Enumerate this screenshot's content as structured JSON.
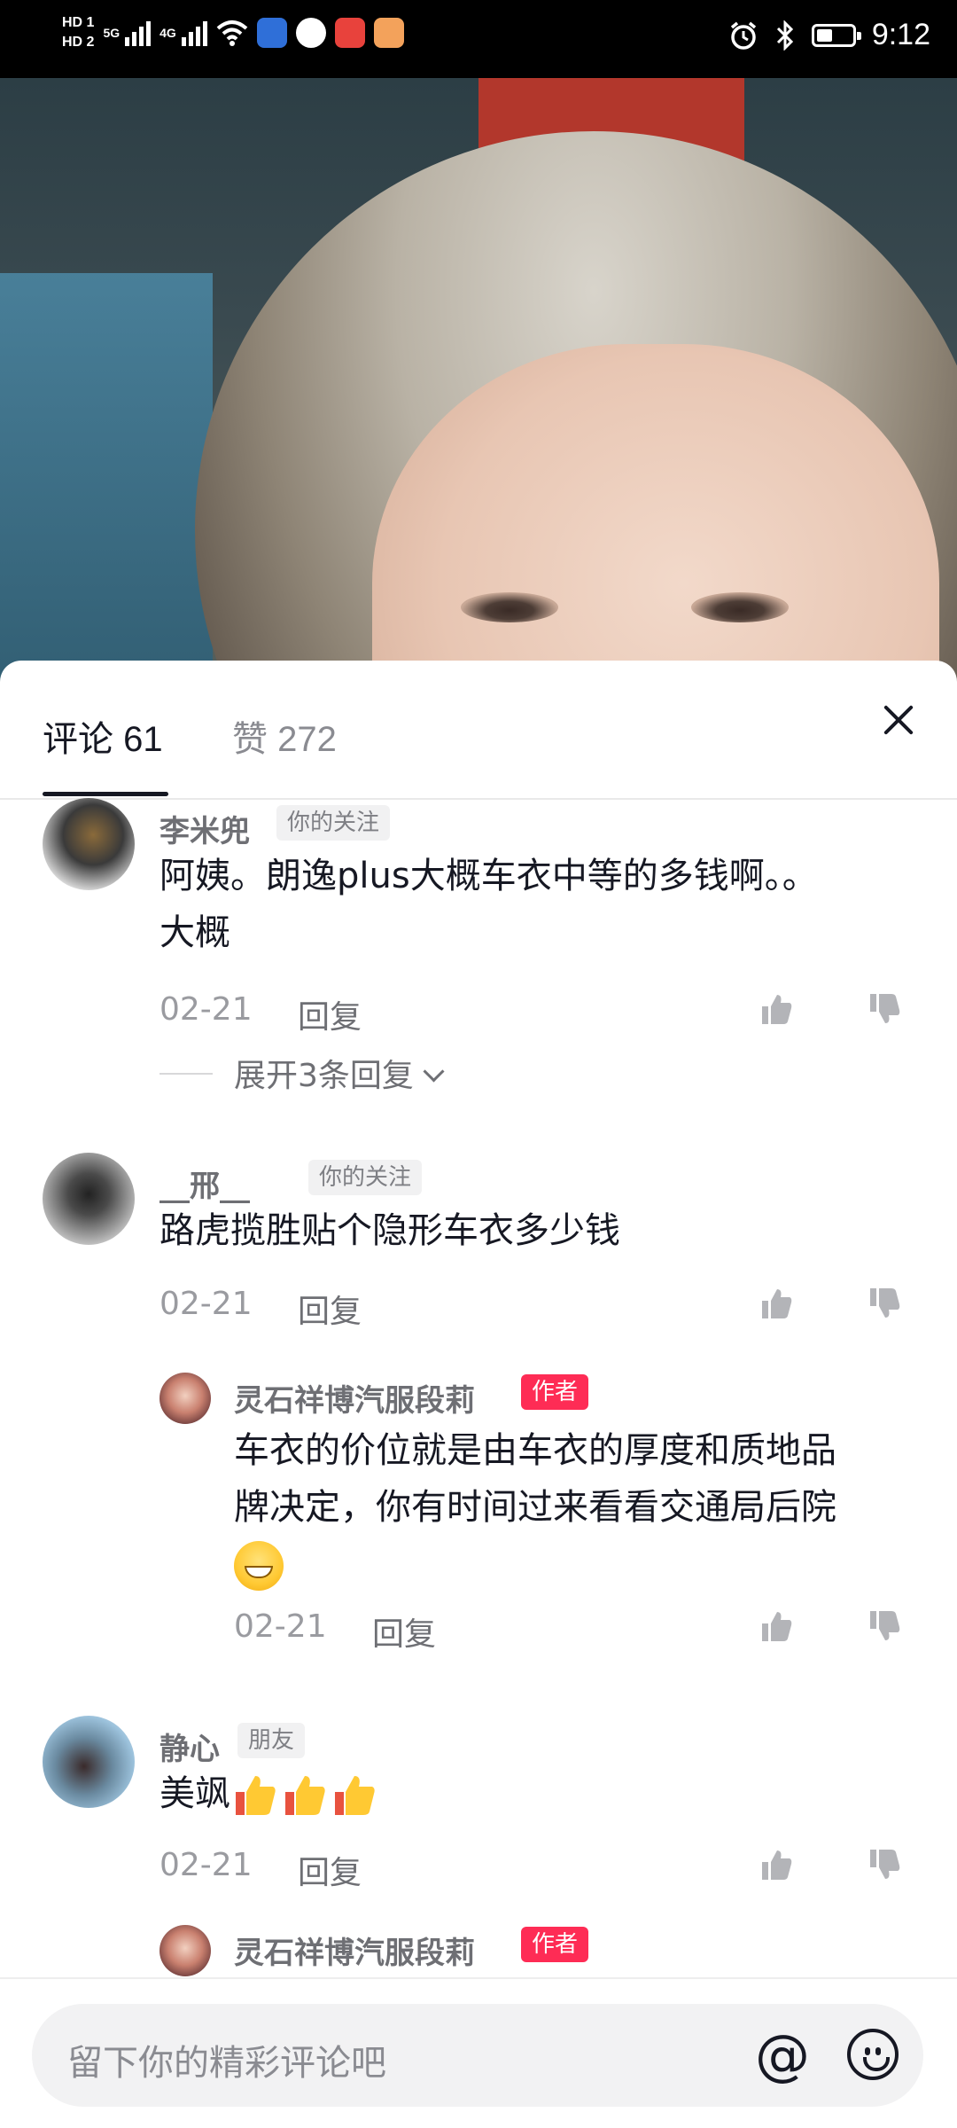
{
  "status_bar": {
    "hd1": "HD 1",
    "hd2": "HD 2",
    "net1": "5G",
    "net2": "4G",
    "time": "9:12",
    "battery_level": 0.45
  },
  "sheet": {
    "tabs": [
      {
        "label": "评论 61"
      },
      {
        "label": "赞 272"
      }
    ]
  },
  "comments": [
    {
      "username": "李米兜",
      "tag": "你的关注",
      "text_line1": "阿姨。朗逸plus大概车衣中等的多钱啊。。",
      "text_line2": "大概",
      "date": "02-21",
      "reply_label": "回复",
      "expand_label": "展开3条回复"
    },
    {
      "username": "__邢__",
      "tag": "你的关注",
      "text": "路虎揽胜贴个隐形车衣多少钱",
      "date": "02-21",
      "reply_label": "回复",
      "reply": {
        "username": "灵石祥博汽服段莉",
        "tag": "作者",
        "text_line1": "车衣的价位就是由车衣的厚度和质地品",
        "text_line2": "牌决定，你有时间过来看看交通局后院",
        "date": "02-21",
        "reply_label": "回复"
      }
    },
    {
      "username": "静心",
      "tag": "朋友",
      "text": "美飒",
      "date": "02-21",
      "reply_label": "回复",
      "reply": {
        "username": "灵石祥博汽服段莉",
        "tag": "作者"
      }
    }
  ],
  "input": {
    "placeholder": "留下你的精彩评论吧",
    "at_symbol": "@"
  },
  "colors": {
    "accent": "#fe2c55",
    "text_primary": "#161823",
    "text_secondary": "#8a8b91"
  }
}
